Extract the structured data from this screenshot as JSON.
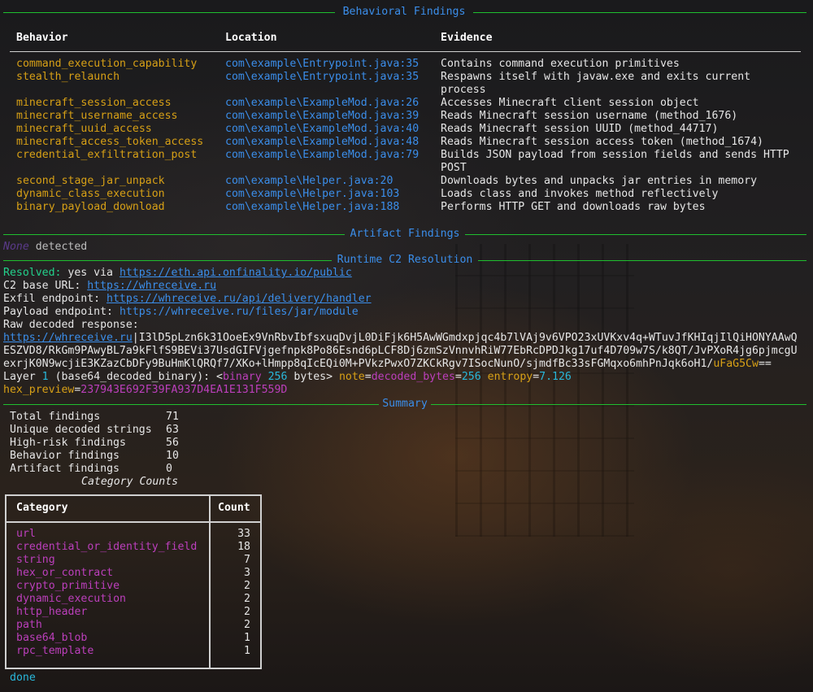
{
  "sections": {
    "behavioral": "Behavioral Findings",
    "artifact": "Artifact Findings",
    "runtime": "Runtime C2 Resolution",
    "summary": "Summary"
  },
  "behavior_table": {
    "headers": [
      "Behavior",
      "Location",
      "Evidence"
    ],
    "rows": [
      {
        "behavior": "command_execution_capability",
        "location": "com\\example\\Entrypoint.java:35",
        "evidence": [
          "Contains command execution primitives"
        ]
      },
      {
        "behavior": "stealth_relaunch",
        "location": "com\\example\\Entrypoint.java:35",
        "evidence": [
          "Respawns itself with javaw.exe and exits current",
          "process"
        ]
      },
      {
        "behavior": "minecraft_session_access",
        "location": "com\\example\\ExampleMod.java:26",
        "evidence": [
          "Accesses Minecraft client session object"
        ]
      },
      {
        "behavior": "minecraft_username_access",
        "location": "com\\example\\ExampleMod.java:39",
        "evidence": [
          "Reads Minecraft session username (method_1676)"
        ]
      },
      {
        "behavior": "minecraft_uuid_access",
        "location": "com\\example\\ExampleMod.java:40",
        "evidence": [
          "Reads Minecraft session UUID (method_44717)"
        ]
      },
      {
        "behavior": "minecraft_access_token_access",
        "location": "com\\example\\ExampleMod.java:48",
        "evidence": [
          "Reads Minecraft session access token (method_1674)"
        ]
      },
      {
        "behavior": "credential_exfiltration_post",
        "location": "com\\example\\ExampleMod.java:79",
        "evidence": [
          "Builds JSON payload from session fields and sends HTTP",
          "POST"
        ]
      },
      {
        "behavior": "second_stage_jar_unpack",
        "location": "com\\example\\Helper.java:20",
        "evidence": [
          "Downloads bytes and unpacks jar entries in memory"
        ]
      },
      {
        "behavior": "dynamic_class_execution",
        "location": "com\\example\\Helper.java:103",
        "evidence": [
          "Loads class and invokes method reflectively"
        ]
      },
      {
        "behavior": "binary_payload_download",
        "location": "com\\example\\Helper.java:188",
        "evidence": [
          "Performs HTTP GET and downloads raw bytes"
        ]
      }
    ]
  },
  "artifact": {
    "none": "None",
    "detected": "detected"
  },
  "runtime": {
    "resolved_label": "Resolved:",
    "resolved_text": "yes via",
    "resolved_url": "https://eth.api.onfinality.io/public",
    "c2_label": "C2 base URL:",
    "c2_url": "https://whreceive.ru",
    "exfil_label": "Exfil endpoint:",
    "exfil_url": "https://whreceive.ru/api/delivery/handler",
    "payload_label": "Payload endpoint:",
    "payload_url": "https://whreceive.ru/files/jar/module",
    "raw_label": "Raw decoded response:",
    "raw_url": "https://whreceive.ru",
    "raw_line1_rest": "|I3lD5pLzn6k31OoeEx9VnRbvIbfsxuqDvjL0DiFjk6H5AwWGmdxpjqc4b7lVAj9v6VPO23xUVKxv4q+WTuvJfKHIqjIlQiHONYAAwQ",
    "raw_line2": "ESZVD8/RkGm9PAwyBL7a9kFlfS9BEVi37UsdGIFVjgefnpk8Po86Esnd6pLCF8Dj6zmSzVnnvhRiW77EbRcDPDJkg17uf4D709w7S/k8QT/JvPXoR4jg6pjmcgU",
    "raw_line3_main": "exrjK0N9wcjiE3KZazCbDFy9BuHmKlQRQf7/XKo+lHmpp8qIcEQi0M+PVkzPwxO7ZKCkRgv7ISocNunO/sjmdfBc33sFGMqxo6mhPnJqk6oH1/",
    "raw_line3_yellow": "uFaG5Cw",
    "raw_line3_end": "==",
    "layer_label": "Layer",
    "layer_num": "1",
    "layer_kind": "(base64_decoded_binary): <",
    "layer_type": "binary",
    "layer_bytes": "256",
    "layer_bytes_unit": "bytes>",
    "note_key": "note",
    "note_val": "decoded_bytes",
    "note_num": "256",
    "entropy_key": "entropy",
    "entropy_val": "7.126",
    "hex_key": "hex_preview",
    "hex_val": "237943E692F39FA937D4EA1E131F559D"
  },
  "summary": {
    "stats": [
      {
        "label": "Total findings",
        "value": "71"
      },
      {
        "label": "Unique decoded strings",
        "value": "63"
      },
      {
        "label": "High-risk findings",
        "value": "56"
      },
      {
        "label": "Behavior findings",
        "value": "10"
      },
      {
        "label": "Artifact findings",
        "value": "0"
      }
    ],
    "counts_title": "Category Counts",
    "counts_headers": [
      "Category",
      "Count"
    ],
    "counts": [
      {
        "category": "url",
        "count": "33"
      },
      {
        "category": "credential_or_identity_field",
        "count": "18"
      },
      {
        "category": "string",
        "count": "7"
      },
      {
        "category": "hex_or_contract",
        "count": "3"
      },
      {
        "category": "crypto_primitive",
        "count": "2"
      },
      {
        "category": "dynamic_execution",
        "count": "2"
      },
      {
        "category": "http_header",
        "count": "2"
      },
      {
        "category": "path",
        "count": "2"
      },
      {
        "category": "base64_blob",
        "count": "1"
      },
      {
        "category": "rpc_template",
        "count": "1"
      }
    ]
  },
  "footer": {
    "done": "done"
  },
  "colors": {
    "rule": "#1fbf2f",
    "title": "#3b8eea",
    "behavior": "#d7a016",
    "category": "#bc3fbc"
  }
}
